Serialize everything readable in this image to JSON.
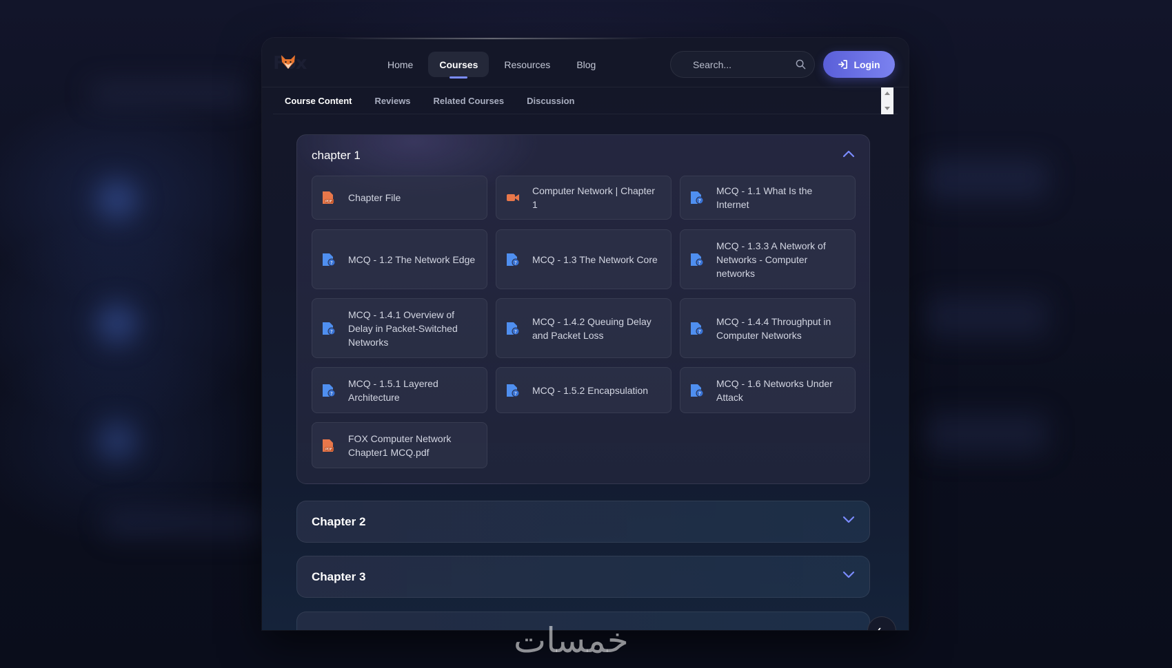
{
  "nav": {
    "logo_text": "Fox",
    "items": [
      {
        "label": "Home",
        "active": false
      },
      {
        "label": "Courses",
        "active": true
      },
      {
        "label": "Resources",
        "active": false
      },
      {
        "label": "Blog",
        "active": false
      }
    ],
    "search_placeholder": "Search...",
    "login_label": "Login"
  },
  "tabs": [
    {
      "label": "Course Content",
      "active": true
    },
    {
      "label": "Reviews",
      "active": false
    },
    {
      "label": "Related Courses",
      "active": false
    },
    {
      "label": "Discussion",
      "active": false
    }
  ],
  "chapters": [
    {
      "title": "chapter 1",
      "expanded": true,
      "items": [
        {
          "label": "Chapter File",
          "icon": "pdf-file-icon"
        },
        {
          "label": "Computer Network | Chapter 1",
          "icon": "video-icon"
        },
        {
          "label": "MCQ - 1.1 What Is the Internet",
          "icon": "quiz-file-icon"
        },
        {
          "label": "MCQ - 1.2 The Network Edge",
          "icon": "quiz-file-icon"
        },
        {
          "label": "MCQ - 1.3 The Network Core",
          "icon": "quiz-file-icon"
        },
        {
          "label": "MCQ - 1.3.3 A Network of Networks - Computer networks",
          "icon": "quiz-file-icon"
        },
        {
          "label": "MCQ - 1.4.1 Overview of Delay in Packet-Switched Networks",
          "icon": "quiz-file-icon"
        },
        {
          "label": "MCQ - 1.4.2 Queuing Delay and Packet Loss",
          "icon": "quiz-file-icon"
        },
        {
          "label": "MCQ - 1.4.4 Throughput in Computer Networks",
          "icon": "quiz-file-icon"
        },
        {
          "label": "MCQ - 1.5.1 Layered Architecture",
          "icon": "quiz-file-icon"
        },
        {
          "label": "MCQ - 1.5.2 Encapsulation",
          "icon": "quiz-file-icon"
        },
        {
          "label": "MCQ - 1.6 Networks Under Attack",
          "icon": "quiz-file-icon"
        },
        {
          "label": "FOX Computer Network Chapter1 MCQ.pdf",
          "icon": "pdf-file-icon"
        }
      ]
    },
    {
      "title": "Chapter 2",
      "expanded": false
    },
    {
      "title": "Chapter 3",
      "expanded": false
    }
  ],
  "watermark": "خمسات",
  "colors": {
    "accent": "#7b8cff",
    "login_gradient_start": "#5a5fd8",
    "login_gradient_end": "#7b82f0",
    "pdf_icon": "#e8774a",
    "quiz_icon": "#4f8ff0"
  }
}
